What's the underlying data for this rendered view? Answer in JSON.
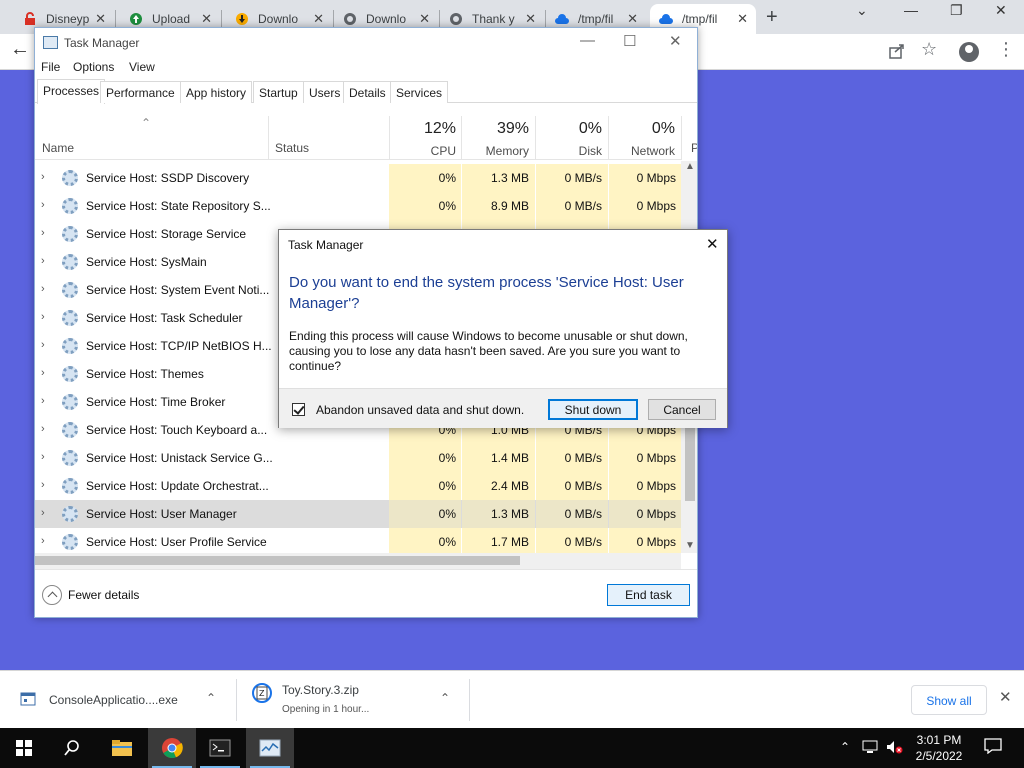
{
  "browser": {
    "tabs": [
      {
        "title": "Disneyp",
        "icon": "lock-icon"
      },
      {
        "title": "Upload",
        "icon": "upload-icon"
      },
      {
        "title": "Downlo",
        "icon": "download-icon"
      },
      {
        "title": "Downlo",
        "icon": "globe-icon"
      },
      {
        "title": "Thank y",
        "icon": "globe-icon"
      },
      {
        "title": "/tmp/fil",
        "icon": "cloud-icon"
      },
      {
        "title": "/tmp/fil",
        "icon": "cloud-icon"
      }
    ]
  },
  "task_manager": {
    "title": "Task Manager",
    "menu": [
      "File",
      "Options",
      "View"
    ],
    "tabs": [
      "Processes",
      "Performance",
      "App history",
      "Startup",
      "Users",
      "Details",
      "Services"
    ],
    "columns": {
      "name": "Name",
      "status": "Status",
      "cpu_pct": "12%",
      "cpu": "CPU",
      "memory_pct": "39%",
      "memory": "Memory",
      "disk_pct": "0%",
      "disk": "Disk",
      "network_pct": "0%",
      "network": "Network",
      "p": "P"
    },
    "processes": [
      {
        "name": "Service Host: SSDP Discovery",
        "cpu": "0%",
        "memory": "1.3 MB",
        "disk": "0 MB/s",
        "network": "0 Mbps"
      },
      {
        "name": "Service Host: State Repository S...",
        "cpu": "0%",
        "memory": "8.9 MB",
        "disk": "0 MB/s",
        "network": "0 Mbps"
      },
      {
        "name": "Service Host: Storage Service",
        "cpu": "",
        "memory": "",
        "disk": "",
        "network": ""
      },
      {
        "name": "Service Host: SysMain",
        "cpu": "",
        "memory": "",
        "disk": "",
        "network": ""
      },
      {
        "name": "Service Host: System Event Noti...",
        "cpu": "",
        "memory": "",
        "disk": "",
        "network": ""
      },
      {
        "name": "Service Host: Task Scheduler",
        "cpu": "",
        "memory": "",
        "disk": "",
        "network": ""
      },
      {
        "name": "Service Host: TCP/IP NetBIOS H...",
        "cpu": "",
        "memory": "",
        "disk": "",
        "network": ""
      },
      {
        "name": "Service Host: Themes",
        "cpu": "",
        "memory": "",
        "disk": "",
        "network": ""
      },
      {
        "name": "Service Host: Time Broker",
        "cpu": "",
        "memory": "",
        "disk": "",
        "network": ""
      },
      {
        "name": "Service Host: Touch Keyboard a...",
        "cpu": "0%",
        "memory": "1.0 MB",
        "disk": "0 MB/s",
        "network": "0 Mbps"
      },
      {
        "name": "Service Host: Unistack Service G...",
        "cpu": "0%",
        "memory": "1.4 MB",
        "disk": "0 MB/s",
        "network": "0 Mbps"
      },
      {
        "name": "Service Host: Update Orchestrat...",
        "cpu": "0%",
        "memory": "2.4 MB",
        "disk": "0 MB/s",
        "network": "0 Mbps"
      },
      {
        "name": "Service Host: User Manager",
        "cpu": "0%",
        "memory": "1.3 MB",
        "disk": "0 MB/s",
        "network": "0 Mbps",
        "selected": true
      },
      {
        "name": "Service Host: User Profile Service",
        "cpu": "0%",
        "memory": "1.7 MB",
        "disk": "0 MB/s",
        "network": "0 Mbps"
      }
    ],
    "fewer_details": "Fewer details",
    "end_task": "End task"
  },
  "dialog": {
    "title": "Task Manager",
    "question": "Do you want to end the system process 'Service Host: User Manager'?",
    "body": "Ending this process will cause Windows to become unusable or shut down, causing you to lose any data hasn't been saved. Are you sure you want to continue?",
    "checkbox_label": "Abandon unsaved data and shut down.",
    "checkbox_checked": true,
    "primary_button": "Shut down",
    "secondary_button": "Cancel"
  },
  "downloads": {
    "items": [
      {
        "name": "ConsoleApplicatio....exe",
        "status": ""
      },
      {
        "name": "Toy.Story.3.zip",
        "status": "Opening in 1 hour..."
      }
    ],
    "show_all": "Show all"
  },
  "taskbar": {
    "time": "3:01 PM",
    "date": "2/5/2022"
  }
}
